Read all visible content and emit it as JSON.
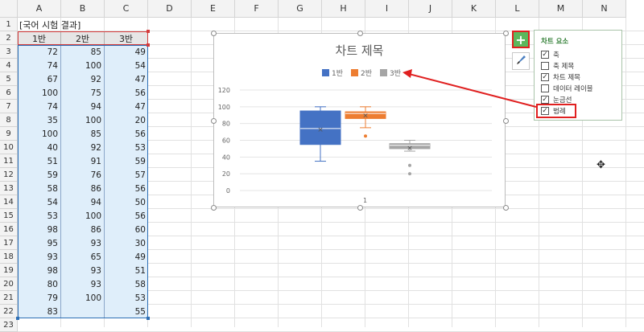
{
  "columns": [
    "A",
    "B",
    "C",
    "D",
    "E",
    "F",
    "G",
    "H",
    "I",
    "J",
    "K",
    "L",
    "M",
    "N"
  ],
  "rows": [
    "1",
    "2",
    "3",
    "4",
    "5",
    "6",
    "7",
    "8",
    "9",
    "10",
    "11",
    "12",
    "13",
    "14",
    "15",
    "16",
    "17",
    "18",
    "19",
    "20",
    "21",
    "22",
    "23"
  ],
  "sheet": {
    "title": "[국어 시험 결과]",
    "headers": [
      "1반",
      "2반",
      "3반"
    ],
    "data": [
      [
        "72",
        "85",
        "49"
      ],
      [
        "74",
        "100",
        "54"
      ],
      [
        "67",
        "92",
        "47"
      ],
      [
        "100",
        "75",
        "56"
      ],
      [
        "74",
        "94",
        "47"
      ],
      [
        "35",
        "100",
        "20"
      ],
      [
        "100",
        "85",
        "56"
      ],
      [
        "40",
        "92",
        "53"
      ],
      [
        "51",
        "91",
        "59"
      ],
      [
        "59",
        "76",
        "57"
      ],
      [
        "58",
        "86",
        "56"
      ],
      [
        "54",
        "94",
        "50"
      ],
      [
        "53",
        "100",
        "56"
      ],
      [
        "98",
        "86",
        "60"
      ],
      [
        "95",
        "93",
        "30"
      ],
      [
        "93",
        "65",
        "49"
      ],
      [
        "98",
        "93",
        "51"
      ],
      [
        "80",
        "93",
        "58"
      ],
      [
        "79",
        "100",
        "53"
      ],
      [
        "83",
        "",
        "55"
      ]
    ]
  },
  "chart": {
    "title": "차트 제목",
    "x_category": "1"
  },
  "chart_data": {
    "type": "box",
    "title": "차트 제목",
    "categories": [
      "1"
    ],
    "ylim": [
      0,
      120
    ],
    "yticks": [
      "0",
      "20",
      "40",
      "60",
      "80",
      "100",
      "120"
    ],
    "legend": "top",
    "series": [
      {
        "name": "1반",
        "color": "#4472c4",
        "min": 35,
        "q1": 55,
        "median": 74,
        "q3": 95,
        "max": 100,
        "mean": 73,
        "outliers": []
      },
      {
        "name": "2반",
        "color": "#ed7d31",
        "min": 75,
        "q1": 86,
        "median": 92,
        "q3": 94,
        "max": 100,
        "mean": 90,
        "outliers": [
          65
        ]
      },
      {
        "name": "3반",
        "color": "#a5a5a5",
        "min": 47,
        "q1": 50,
        "median": 54,
        "q3": 56,
        "max": 60,
        "mean": 51,
        "outliers": [
          30,
          20
        ]
      }
    ]
  },
  "panel": {
    "title": "차트 요소",
    "options": [
      {
        "label": "축",
        "checked": true
      },
      {
        "label": "축 제목",
        "checked": false
      },
      {
        "label": "차트 제목",
        "checked": true
      },
      {
        "label": "데이터 레이블",
        "checked": false
      },
      {
        "label": "눈금선",
        "checked": true
      },
      {
        "label": "범례",
        "checked": true
      }
    ]
  },
  "icons": {
    "add_element": "plus-icon",
    "style": "brush-icon",
    "cursor": "crosshair-cursor-icon"
  }
}
